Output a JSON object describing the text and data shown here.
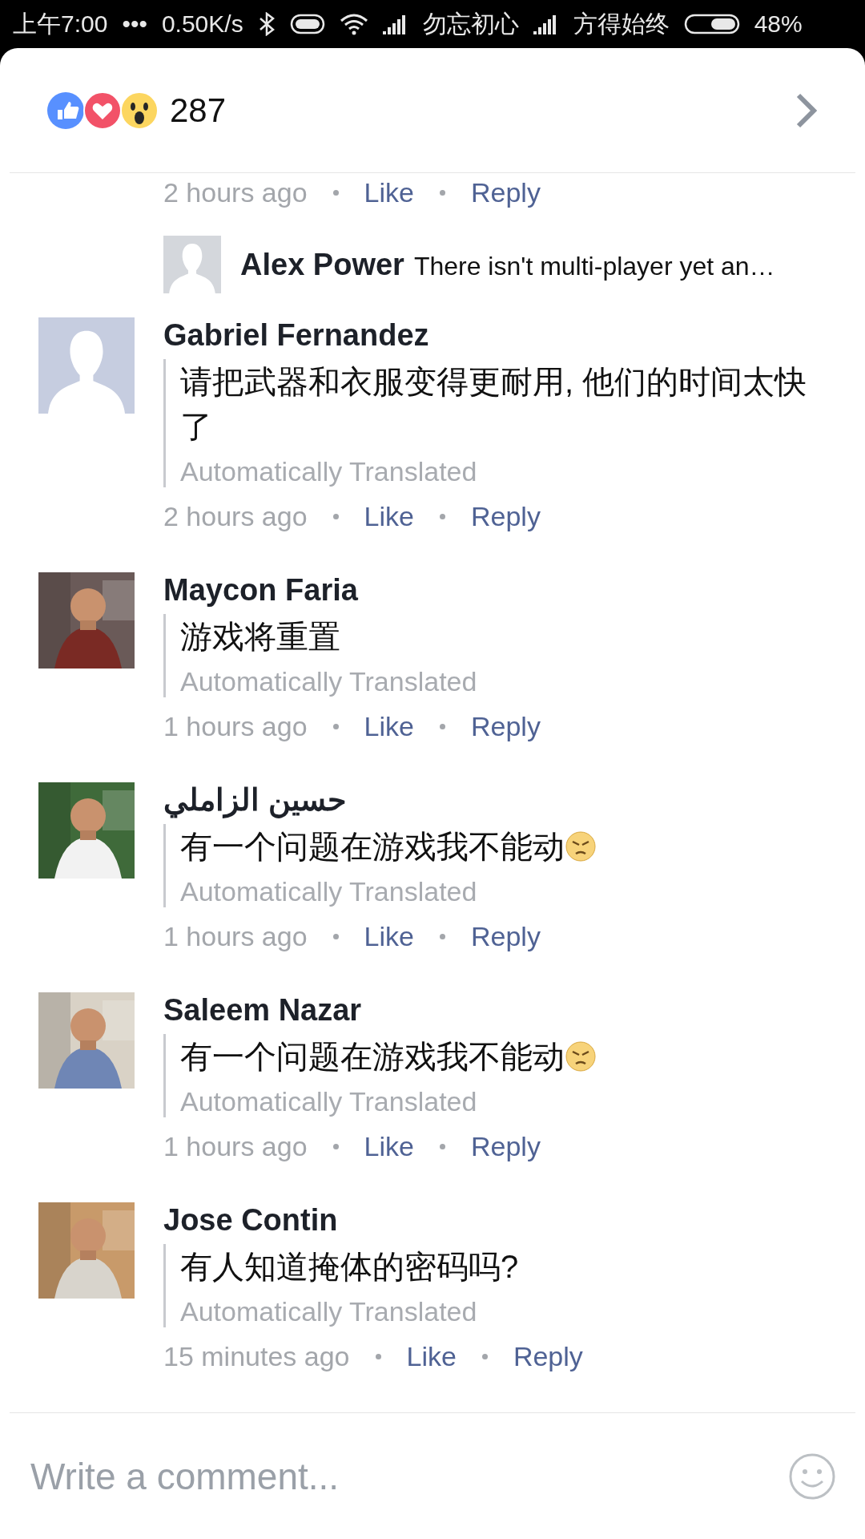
{
  "status_bar": {
    "time": "上午7:00",
    "dots": "•••",
    "speed": "0.50K/s",
    "carrier_1": "勿忘初心",
    "carrier_2": "方得始终",
    "battery": "48%"
  },
  "header": {
    "reaction_count": "287"
  },
  "previous_meta": {
    "time": "2 hours ago",
    "like": "Like",
    "reply": "Reply"
  },
  "reply_preview": {
    "name": "Alex Power",
    "text": "There isn't multi-player yet an…"
  },
  "comments": [
    {
      "name": "Gabriel Fernandez",
      "kind": "placeholder",
      "angry_emoji": false,
      "text": "请把武器和衣服变得更耐用, 他们的时间太快了",
      "translated": "Automatically Translated",
      "time": "2 hours ago",
      "like": "Like",
      "reply": "Reply"
    },
    {
      "name": "Maycon Faria",
      "kind": "picture",
      "angry_emoji": false,
      "text": "游戏将重置",
      "translated": "Automatically Translated",
      "time": "1 hours ago",
      "like": "Like",
      "reply": "Reply"
    },
    {
      "name": "حسين الزاملي",
      "kind": "picture",
      "angry_emoji": true,
      "text": "有一个问题在游戏我不能动",
      "translated": "Automatically Translated",
      "time": "1 hours ago",
      "like": "Like",
      "reply": "Reply"
    },
    {
      "name": "Saleem Nazar",
      "kind": "picture",
      "angry_emoji": true,
      "text": "有一个问题在游戏我不能动",
      "translated": "Automatically Translated",
      "time": "1 hours ago",
      "like": "Like",
      "reply": "Reply"
    },
    {
      "name": "Jose Contin",
      "kind": "picture",
      "angry_emoji": false,
      "text": "有人知道掩体的密码吗?",
      "translated": "Automatically Translated",
      "time": "15 minutes ago",
      "like": "Like",
      "reply": "Reply"
    }
  ],
  "composer": {
    "placeholder": "Write a comment..."
  }
}
